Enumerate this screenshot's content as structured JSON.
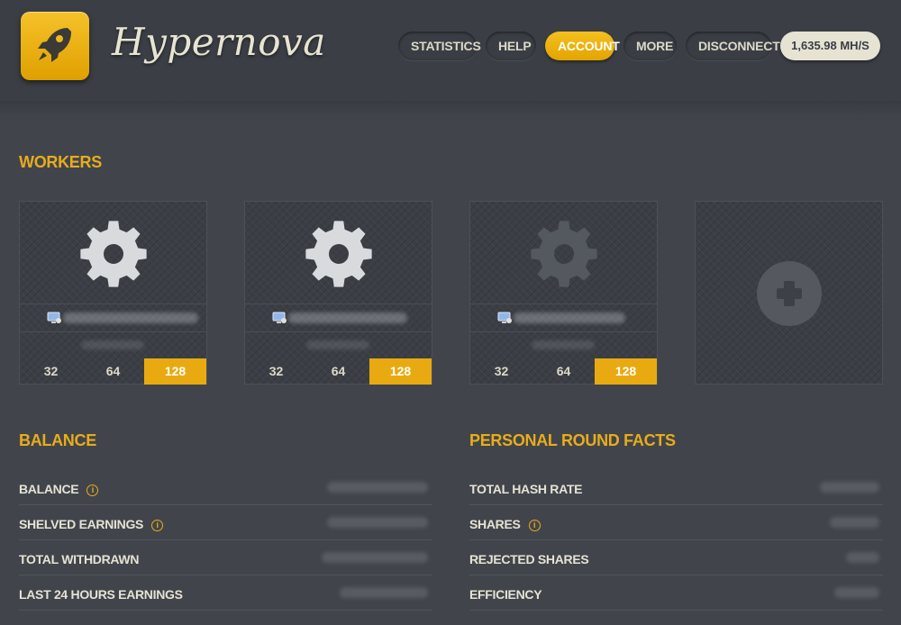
{
  "header": {
    "brand": "Hypernova",
    "nav": [
      {
        "label": "STATISTICS",
        "active": false
      },
      {
        "label": "HELP",
        "active": false
      },
      {
        "label": "ACCOUNT",
        "active": true
      },
      {
        "label": "MORE",
        "active": false
      },
      {
        "label": "DISCONNECT",
        "active": false
      }
    ],
    "hashrate": "1,635.98 MH/S"
  },
  "workers": {
    "title": "WORKERS",
    "cards": [
      {
        "intensity_options": [
          "32",
          "64",
          "128"
        ],
        "selected": "128",
        "gear_state": "active"
      },
      {
        "intensity_options": [
          "32",
          "64",
          "128"
        ],
        "selected": "128",
        "gear_state": "active"
      },
      {
        "intensity_options": [
          "32",
          "64",
          "128"
        ],
        "selected": "128",
        "gear_state": "inactive"
      }
    ]
  },
  "balance": {
    "title": "BALANCE",
    "rows": [
      {
        "label": "BALANCE",
        "info": true
      },
      {
        "label": "SHELVED EARNINGS",
        "info": true
      },
      {
        "label": "TOTAL WITHDRAWN",
        "info": false
      },
      {
        "label": "LAST 24 HOURS EARNINGS",
        "info": false
      }
    ]
  },
  "round_facts": {
    "title": "PERSONAL ROUND FACTS",
    "rows": [
      {
        "label": "TOTAL HASH RATE",
        "info": false
      },
      {
        "label": "SHARES",
        "info": true
      },
      {
        "label": "REJECTED SHARES",
        "info": false
      },
      {
        "label": "EFFICIENCY",
        "info": false
      }
    ]
  },
  "colors": {
    "accent": "#e8ac1c",
    "background": "#41454b",
    "header": "#3b3f45",
    "text": "#e6e2d4"
  },
  "icons": [
    "rocket-icon",
    "gear-icon",
    "computer-icon",
    "plus-icon",
    "info-icon"
  ]
}
